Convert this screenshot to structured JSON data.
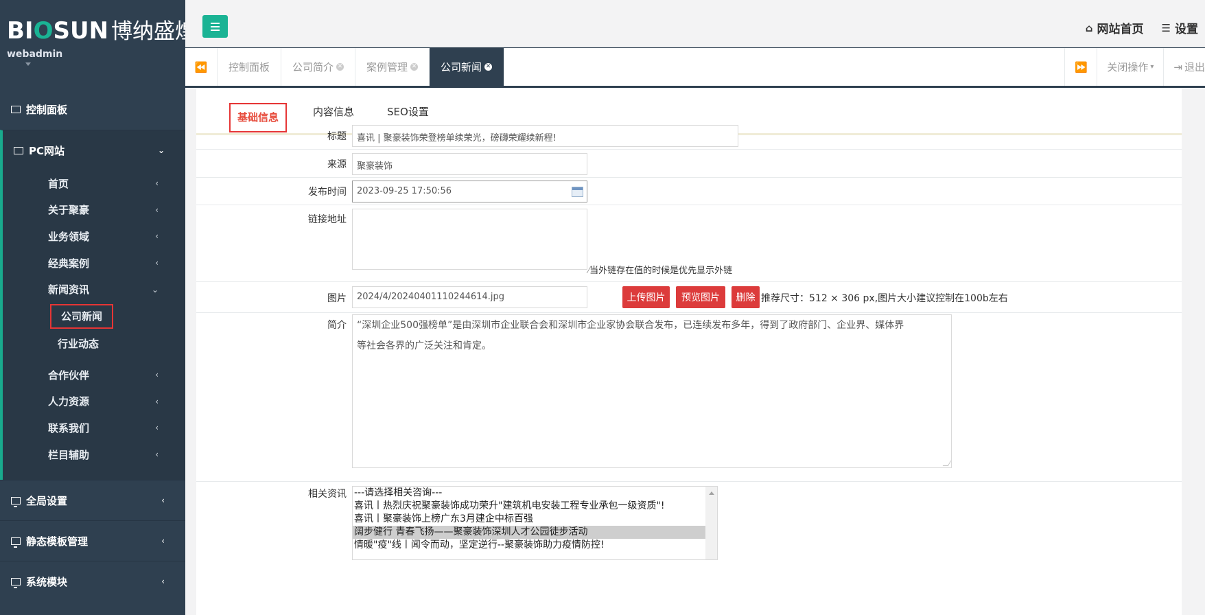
{
  "brand": {
    "logo_a": "BI",
    "logo_o": "O",
    "logo_b": "SUN",
    "logo_cn": "博纳盛煌",
    "user": "webadmin"
  },
  "colors": {
    "sidebar": "#2f4050",
    "accent": "#1ab394",
    "danger": "#dc3b3b",
    "highlight_box": "#e63535"
  },
  "sidebar": {
    "dashboard": "控制面板",
    "pc_site": "PC网站",
    "pc_items": [
      {
        "label": "首页"
      },
      {
        "label": "关于聚豪"
      },
      {
        "label": "业务领域"
      },
      {
        "label": "经典案例"
      },
      {
        "label": "新闻资讯"
      }
    ],
    "news_children": [
      {
        "label": "公司新闻"
      },
      {
        "label": "行业动态"
      }
    ],
    "pc_items_after": [
      {
        "label": "合作伙伴"
      },
      {
        "label": "人力资源"
      },
      {
        "label": "联系我们"
      },
      {
        "label": "栏目辅助"
      }
    ],
    "global_settings": "全局设置",
    "template_mgmt": "静态模板管理",
    "system_modules": "系统模块"
  },
  "header": {
    "home_link": "网站首页",
    "settings_link": "设置"
  },
  "tabs": [
    {
      "label": "控制面板"
    },
    {
      "label": "公司简介"
    },
    {
      "label": "案例管理"
    },
    {
      "label": "公司新闻"
    }
  ],
  "tab_actions": {
    "close_ops": "关闭操作",
    "logout": "退出"
  },
  "form_tabs": [
    "基础信息",
    "内容信息",
    "SEO设置"
  ],
  "form": {
    "title_label": "标题",
    "title_value": "喜讯 | 聚豪装饰荣登榜单续荣光，磅礴荣耀续新程!",
    "source_label": "来源",
    "source_value": "聚豪装饰",
    "publish_label": "发布时间",
    "publish_value": "2023-09-25 17:50:56",
    "link_label": "链接地址",
    "link_value": "",
    "link_hint": "当外链存在值的时候是优先显示外链",
    "image_label": "图片",
    "image_value": "2024/4/20240401110244614.jpg",
    "upload_btn": "上传图片",
    "preview_btn": "预览图片",
    "delete_btn": "删除",
    "image_hint": "推荐尺寸：512 × 306 px,图片大小建议控制在100b左右",
    "summary_label": "简介",
    "summary_line1": "“深圳企业500强榜单”是由深圳市企业联合会和深圳市企业家协会联合发布，已连续发布多年，得到了政府部门、企业界、媒体界",
    "summary_line2": "等社会各界的广泛关注和肯定。",
    "related_label": "相关资讯",
    "related_options": [
      "---请选择相关咨询---",
      "喜讯丨热烈庆祝聚豪装饰成功荣升\"建筑机电安装工程专业承包一级资质\"!",
      "喜讯丨聚豪装饰上榜广东3月建企中标百强",
      "阔步健行 青春飞扬——聚豪装饰深圳人才公园徒步活动",
      "情暖\"疫\"线丨闻令而动，坚定逆行--聚豪装饰助力疫情防控!"
    ]
  }
}
